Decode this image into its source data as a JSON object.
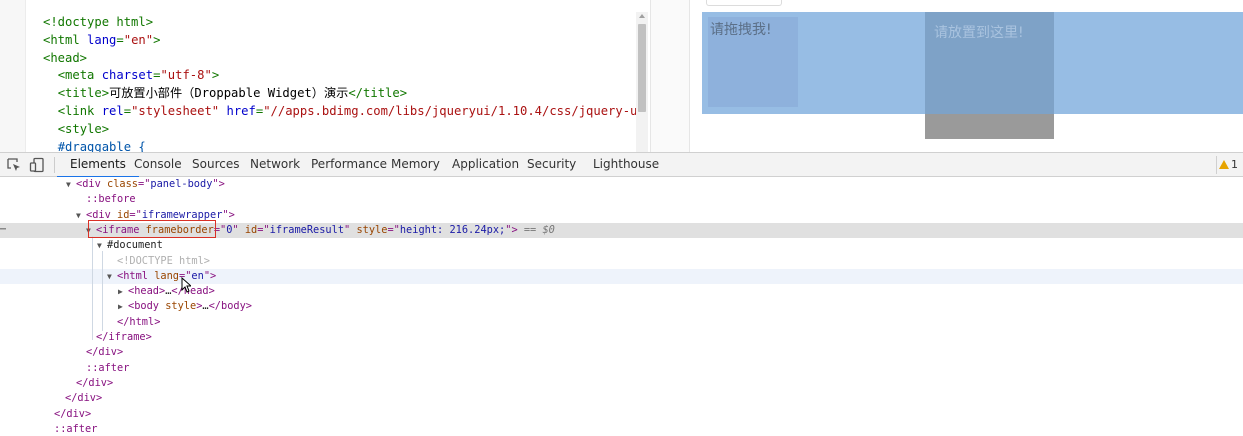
{
  "editor": {
    "lines": [
      [
        [
          "t-tag",
          "<!doctype html>"
        ]
      ],
      [
        [
          "t-tag",
          "<html "
        ],
        [
          "t-attr",
          "lang"
        ],
        [
          "t-tag",
          "="
        ],
        [
          "t-str",
          "\"en\""
        ],
        [
          "t-tag",
          ">"
        ]
      ],
      [
        [
          "t-tag",
          "<head>"
        ]
      ],
      [
        [
          "t-txt",
          "  "
        ],
        [
          "t-tag",
          "<meta "
        ],
        [
          "t-attr",
          "charset"
        ],
        [
          "t-tag",
          "="
        ],
        [
          "t-str",
          "\"utf-8\""
        ],
        [
          "t-tag",
          ">"
        ]
      ],
      [
        [
          "t-txt",
          "  "
        ],
        [
          "t-tag",
          "<title>"
        ],
        [
          "t-txt",
          "可放置小部件（Droppable Widget）演示"
        ],
        [
          "t-tag",
          "</title>"
        ]
      ],
      [
        [
          "t-txt",
          "  "
        ],
        [
          "t-tag",
          "<link "
        ],
        [
          "t-attr",
          "rel"
        ],
        [
          "t-tag",
          "="
        ],
        [
          "t-str",
          "\"stylesheet\""
        ],
        [
          "t-txt",
          " "
        ],
        [
          "t-attr",
          "href"
        ],
        [
          "t-tag",
          "="
        ],
        [
          "t-str",
          "\"//apps.bdimg.com/libs/jqueryui/1.10.4/css/jquery-ui.min."
        ]
      ],
      [
        [
          "t-txt",
          "  "
        ],
        [
          "t-tag",
          "<style>"
        ]
      ],
      [
        [
          "t-txt",
          "  "
        ],
        [
          "t-sel",
          "#draggable {"
        ]
      ]
    ]
  },
  "preview": {
    "drag_label": "请拖拽我!",
    "drop_label": "请放置到这里!",
    "colors": {
      "banner": "#97bde4",
      "drag": "#8eb1dc",
      "drop": "#7ea2c7",
      "drop_lower": "#9a9a9a"
    }
  },
  "devtools": {
    "icons": [
      "inspect-element-icon",
      "device-toolbar-icon"
    ],
    "tabs": [
      {
        "label": "Elements",
        "active": true
      },
      {
        "label": "Console"
      },
      {
        "label": "Sources"
      },
      {
        "label": "Network"
      },
      {
        "label": "Performance"
      },
      {
        "label": "Memory"
      },
      {
        "label": "Application"
      },
      {
        "label": "Security"
      },
      {
        "label": "Lighthouse"
      }
    ],
    "warning_count": "1",
    "accent": "#1a73e8"
  },
  "tree": {
    "rows": [
      {
        "arrow": "▼",
        "parts": [
          [
            "tn",
            "<div "
          ],
          [
            "an",
            "class"
          ],
          [
            "tn",
            "=\""
          ],
          [
            "av",
            "panel-body"
          ],
          [
            "tn",
            "\">"
          ]
        ]
      },
      {
        "arrow": "",
        "parts": [
          [
            "pe",
            "::before"
          ]
        ]
      },
      {
        "arrow": "▼",
        "parts": [
          [
            "tn",
            "<div "
          ],
          [
            "an",
            "id"
          ],
          [
            "tn",
            "=\""
          ],
          [
            "av",
            "iframewrapper"
          ],
          [
            "tn",
            "\">"
          ]
        ]
      },
      {
        "arrow": "▼",
        "state": "selected",
        "parts": [
          [
            "tn",
            "<iframe "
          ],
          [
            "an",
            "frameborder"
          ],
          [
            "tn",
            "=\""
          ],
          [
            "av",
            "0"
          ],
          [
            "tn",
            "\" "
          ],
          [
            "an",
            "id"
          ],
          [
            "tn",
            "=\""
          ],
          [
            "av",
            "iframeResult"
          ],
          [
            "tn",
            "\" "
          ],
          [
            "an",
            "style"
          ],
          [
            "tn",
            "=\""
          ],
          [
            "av",
            "height: 216.24px;"
          ],
          [
            "tn",
            "\">"
          ],
          [
            "dtxt",
            " "
          ],
          [
            "eq0",
            "== $0"
          ]
        ]
      },
      {
        "arrow": "▼",
        "parts": [
          [
            "dtxt",
            "#document"
          ]
        ]
      },
      {
        "arrow": "",
        "parts": [
          [
            "dim",
            "<!DOCTYPE html>"
          ]
        ]
      },
      {
        "arrow": "▼",
        "state": "hovered",
        "parts": [
          [
            "tn",
            "<html "
          ],
          [
            "an",
            "lang"
          ],
          [
            "tn",
            "=\""
          ],
          [
            "av",
            "en"
          ],
          [
            "tn",
            "\">"
          ]
        ]
      },
      {
        "arrow": "▶",
        "parts": [
          [
            "tn",
            "<head>"
          ],
          [
            "dtxt",
            "…"
          ],
          [
            "tn",
            "</head>"
          ]
        ]
      },
      {
        "arrow": "▶",
        "parts": [
          [
            "tn",
            "<body "
          ],
          [
            "an",
            "style"
          ],
          [
            "tn",
            ">"
          ],
          [
            "dtxt",
            "…"
          ],
          [
            "tn",
            "</body>"
          ]
        ]
      },
      {
        "arrow": "",
        "parts": [
          [
            "tn",
            "</html>"
          ]
        ]
      },
      {
        "arrow": "",
        "parts": [
          [
            "tn",
            "</iframe>"
          ]
        ]
      },
      {
        "arrow": "",
        "parts": [
          [
            "tn",
            "</div>"
          ]
        ]
      },
      {
        "arrow": "",
        "parts": [
          [
            "pe",
            "::after"
          ]
        ]
      },
      {
        "arrow": "",
        "parts": [
          [
            "tn",
            "</div>"
          ]
        ]
      },
      {
        "arrow": "",
        "parts": [
          [
            "tn",
            "</div>"
          ]
        ]
      },
      {
        "arrow": "",
        "parts": [
          [
            "tn",
            "</div>"
          ]
        ]
      },
      {
        "arrow": "",
        "parts": [
          [
            "pe",
            "::after"
          ]
        ]
      }
    ],
    "row_dots": "⋯"
  }
}
